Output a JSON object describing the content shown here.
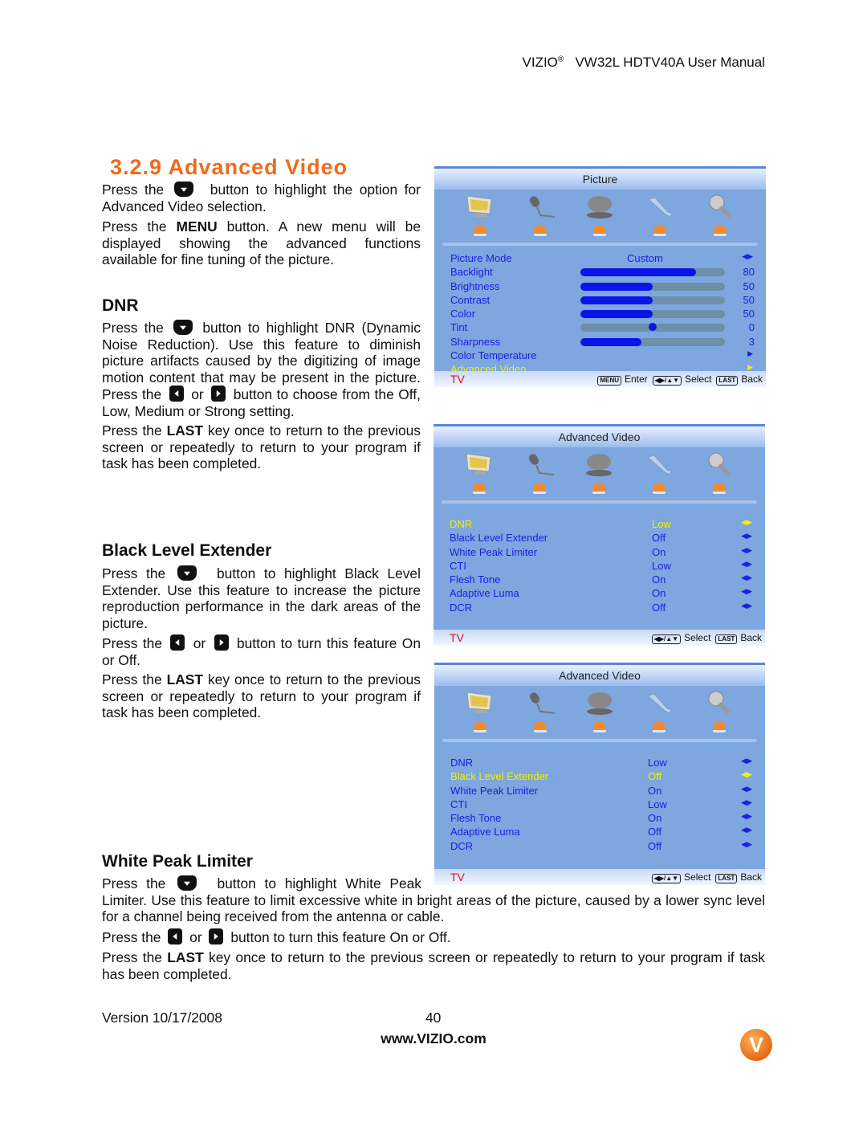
{
  "header": {
    "brand": "VIZIO",
    "reg": "®",
    "title": "VW32L HDTV40A User Manual"
  },
  "section": {
    "title": "3.2.9 Advanced Video",
    "p1": [
      "Press the",
      "button to highlight the option for Advanced Video selection."
    ],
    "p2": [
      "Press the ",
      "MENU",
      " button.  A new menu will be displayed showing the advanced functions available for fine tuning of the picture."
    ]
  },
  "dnr": {
    "title": "DNR",
    "p1": [
      "Press the",
      "button to highlight DNR (Dynamic Noise Reduction).  Use this feature to diminish picture artifacts caused by the digitizing of image motion content that may be present in the picture. Press the",
      "or",
      "button to choose from the Off, Low, Medium or Strong setting."
    ],
    "p2": [
      "Press the ",
      "LAST",
      " key once to return to the previous screen or repeatedly to return to your program if task has been completed."
    ]
  },
  "ble": {
    "title": "Black Level Extender",
    "p1": [
      "Press the",
      "button to highlight Black Level Extender.  Use this feature to increase the picture reproduction performance in the dark areas of the picture."
    ],
    "p2": [
      "Press the",
      "or",
      "button to turn this feature On or Off."
    ],
    "p3": [
      "Press the ",
      "LAST",
      " key once to return to the previous screen or repeatedly to return to your program if task has been completed."
    ]
  },
  "wpl": {
    "title": "White Peak Limiter",
    "p1": [
      "Press the",
      "button to highlight White Peak Limiter.  Use this feature to limit excessive white in bright areas of the picture, caused by a lower sync level for a channel being received from the antenna or cable."
    ],
    "p2": [
      "Press the",
      "or",
      "button to turn this feature On or Off."
    ],
    "p3": [
      "Press the ",
      "LAST",
      " key once to return to the previous screen or repeatedly to return to your program if task has been completed."
    ]
  },
  "menus": [
    {
      "title": "Picture",
      "rows": [
        {
          "label": "Picture Mode",
          "value": "Custom",
          "control": "◀▶"
        },
        {
          "label": "Backlight",
          "value": "80",
          "bar": 80
        },
        {
          "label": "Brightness",
          "value": "50",
          "bar": 50
        },
        {
          "label": "Contrast",
          "value": "50",
          "bar": 50
        },
        {
          "label": "Color",
          "value": "50",
          "bar": 50
        },
        {
          "label": "Tint",
          "value": "0",
          "knob": 0
        },
        {
          "label": "Sharpness",
          "value": "3",
          "bar": 42
        },
        {
          "label": "Color Temperature",
          "control": "▶"
        },
        {
          "label": "Advanced Video",
          "control": "▶",
          "selected": true
        }
      ],
      "footer": {
        "tv": "TV",
        "menu_key": "MENU",
        "enter": "Enter",
        "nav_key": "◀▶/▲▼",
        "select": "Select",
        "last_key": "LAST",
        "back": "Back"
      }
    },
    {
      "title": "Advanced Video",
      "rows": [
        {
          "label": "DNR",
          "value": "Low",
          "control": "◀▶",
          "selected": true
        },
        {
          "label": "Black Level Extender",
          "value": "Off",
          "control": "◀▶"
        },
        {
          "label": "White Peak Limiter",
          "value": "On",
          "control": "◀▶"
        },
        {
          "label": "CTI",
          "value": "Low",
          "control": "◀▶"
        },
        {
          "label": "Flesh Tone",
          "value": "On",
          "control": "◀▶"
        },
        {
          "label": "Adaptive Luma",
          "value": "On",
          "control": "◀▶"
        },
        {
          "label": "DCR",
          "value": "Off",
          "control": "◀▶"
        }
      ],
      "footer": {
        "tv": "TV",
        "nav_key": "◀▶/▲▼",
        "select": "Select",
        "last_key": "LAST",
        "back": "Back"
      }
    },
    {
      "title": "Advanced Video",
      "rows": [
        {
          "label": "DNR",
          "value": "Low",
          "control": "◀▶"
        },
        {
          "label": "Black Level Extender",
          "value": "Off",
          "control": "◀▶",
          "selected": true
        },
        {
          "label": "White Peak Limiter",
          "value": "On",
          "control": "◀▶"
        },
        {
          "label": "CTI",
          "value": "Low",
          "control": "◀▶"
        },
        {
          "label": "Flesh Tone",
          "value": "On",
          "control": "◀▶"
        },
        {
          "label": "Adaptive Luma",
          "value": "Off",
          "control": "◀▶"
        },
        {
          "label": "DCR",
          "value": "Off",
          "control": "◀▶"
        }
      ],
      "footer": {
        "tv": "TV",
        "nav_key": "◀▶/▲▼",
        "select": "Select",
        "last_key": "LAST",
        "back": "Back"
      }
    }
  ],
  "footer": {
    "version": "Version 10/17/2008",
    "page": "40",
    "url": "www.VIZIO.com",
    "logo": "V"
  },
  "colors": {
    "heading": "#f26a1b",
    "menu_bg": "#7ea6df",
    "menu_text": "#1a1ee0",
    "menu_selected": "#f4f000",
    "tv_label": "#e01010"
  }
}
